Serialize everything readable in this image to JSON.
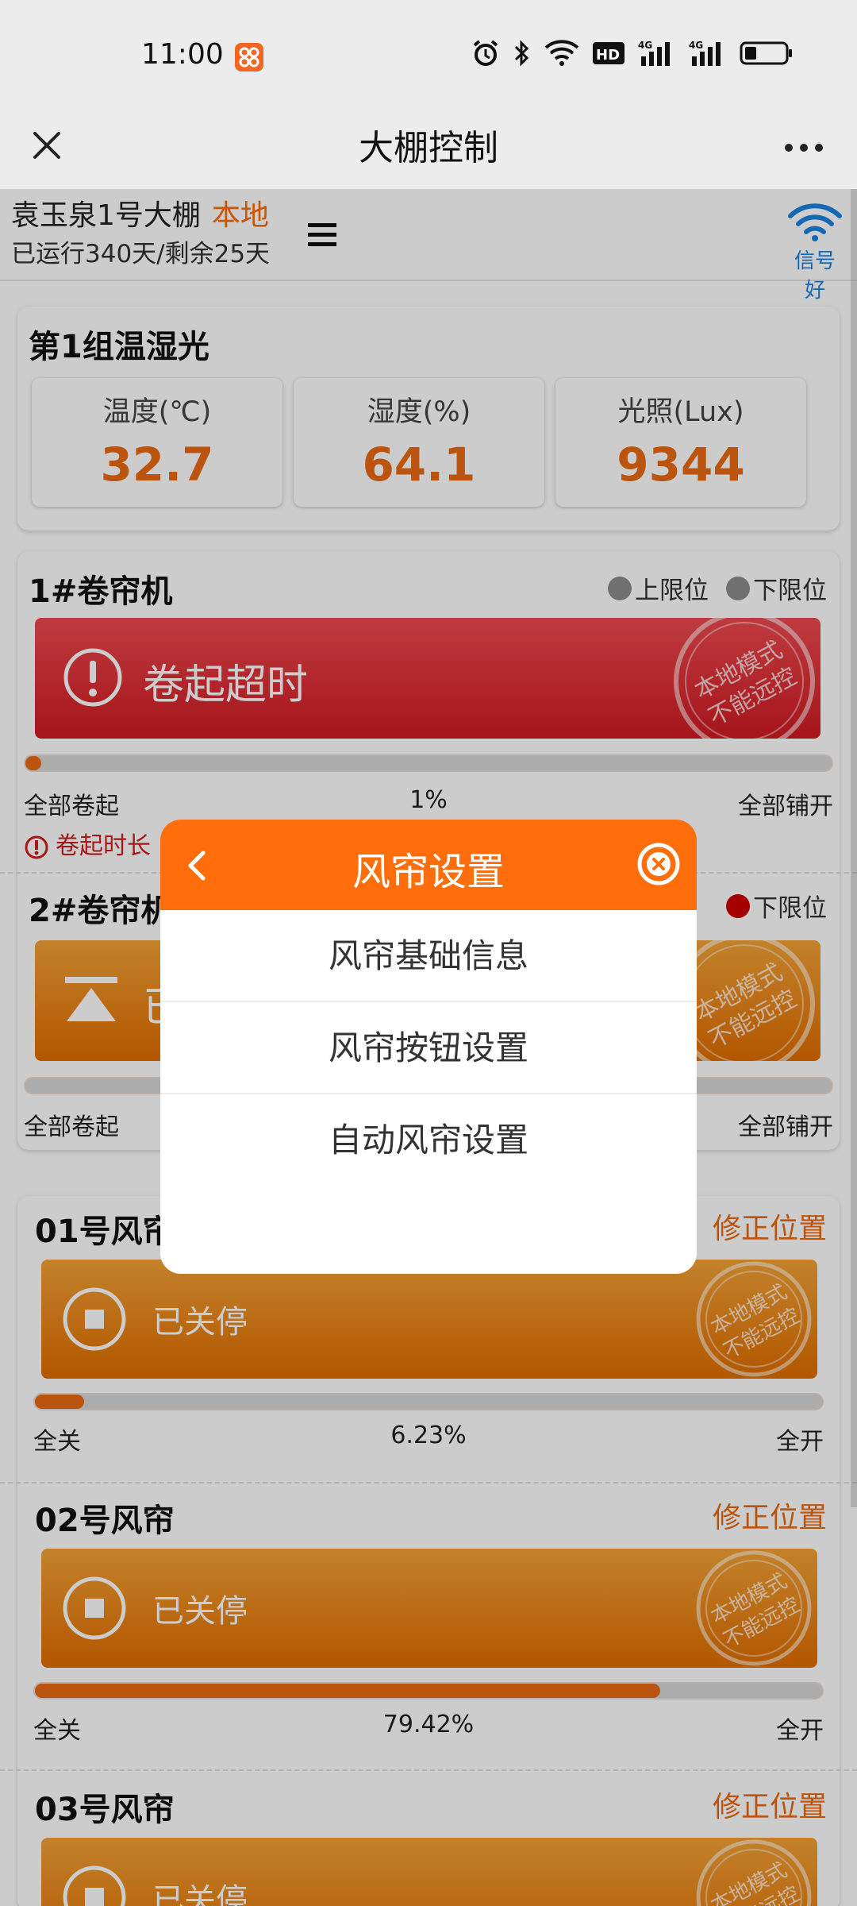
{
  "status_bar": {
    "time": "11:00",
    "app_badge": "⊠",
    "network_badge": "HD",
    "signal_1": "4G",
    "signal_2": "4G"
  },
  "titlebar": {
    "title": "大棚控制"
  },
  "header": {
    "farm_name": "袁玉泉1号大棚",
    "mode": "本地",
    "running": "已运行340天/剩余25天",
    "signal_label": "信号好",
    "signal_color": "#1a82e2"
  },
  "sensors": {
    "title": "第1组温湿光",
    "items": [
      {
        "label": "温度(℃)",
        "value": "32.7"
      },
      {
        "label": "湿度(%)",
        "value": "64.1"
      },
      {
        "label": "光照(Lux)",
        "value": "9344"
      }
    ]
  },
  "roller1": {
    "title": "1#卷帘机",
    "upper": "上限位",
    "lower": "下限位",
    "button": "卷起超时",
    "stamp_line1": "本地模式",
    "stamp_line2": "不能远控",
    "progress": 0.01,
    "left": "全部卷起",
    "percent": "1%",
    "right": "全部铺开",
    "warning": "卷起时长"
  },
  "roller2": {
    "title": "2#卷帘机",
    "lower": "下限位",
    "button_partial": "已",
    "stamp_line1": "本地模式",
    "stamp_line2": "不能远控",
    "left": "全部卷起",
    "right": "全部铺开"
  },
  "wind": [
    {
      "title": "01号风帘",
      "title_visible": "01号风帘",
      "fix": "修正位置",
      "status": "已关停",
      "progress": 0.0623,
      "left": "全关",
      "percent": "6.23%",
      "right": "全开"
    },
    {
      "title": "02号风帘",
      "title_visible": "02号风帘",
      "fix": "修正位置",
      "status": "已关停",
      "progress": 0.7942,
      "left": "全关",
      "percent": "79.42%",
      "right": "全开"
    },
    {
      "title": "03号风帘",
      "title_visible": "03号风帘",
      "fix": "修正位置",
      "status": "已关停"
    }
  ],
  "stamp": {
    "line1": "本地模式",
    "line2": "不能远控"
  },
  "modal": {
    "title": "风帘设置",
    "items": [
      "风帘基础信息",
      "风帘按钮设置",
      "自动风帘设置"
    ]
  },
  "colors": {
    "accent_orange": "#ff6e0a",
    "value_orange": "#ea6a12",
    "alarm_red": "#cf1a22"
  }
}
